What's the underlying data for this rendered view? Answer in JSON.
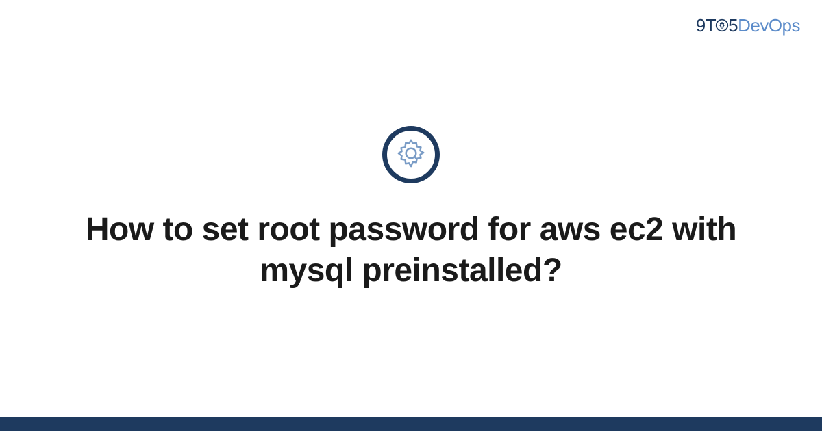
{
  "header": {
    "logo": {
      "part1": "9T",
      "part2": "5",
      "part3": "DevOps"
    }
  },
  "main": {
    "title": "How to set root password for aws ec2 with mysql preinstalled?"
  },
  "colors": {
    "primary": "#1e3a5f",
    "accent": "#5b8bc9"
  }
}
